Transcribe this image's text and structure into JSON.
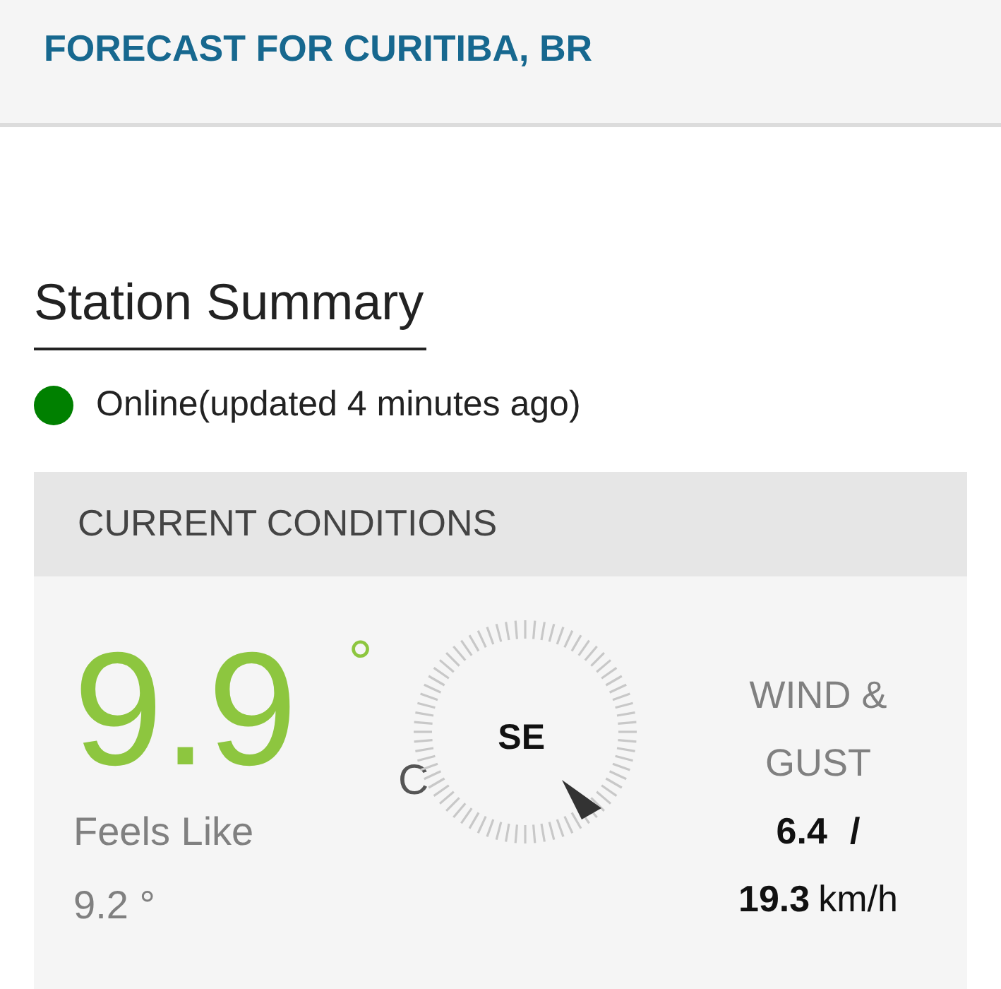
{
  "header": {
    "title": "FORECAST FOR CURITIBA, BR"
  },
  "station_summary": {
    "heading": "Station Summary",
    "status": {
      "text": "Online(updated 4 minutes ago)",
      "color": "#008000"
    }
  },
  "current_conditions": {
    "title": "CURRENT CONDITIONS",
    "temperature": "9.9",
    "degree": "°",
    "unit": "C",
    "feels_like_label": "Feels Like",
    "feels_like": "9.2 °",
    "wind": {
      "direction": "SE",
      "label": "WIND & GUST",
      "speed": "6.4",
      "separator": "/",
      "gust": "19.3",
      "unit": "km/h"
    }
  }
}
